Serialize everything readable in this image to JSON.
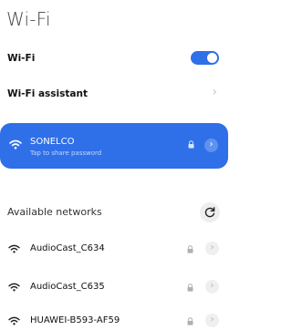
{
  "page": {
    "title": "Wi-Fi"
  },
  "wifi_toggle": {
    "label": "Wi-Fi",
    "state": "on",
    "accent_color": "#2f6fe8"
  },
  "wifi_assistant": {
    "label": "Wi-Fi assistant",
    "chevron": "chevron-right-icon"
  },
  "connected_network": {
    "ssid": "SONELCO",
    "subtitle": "Tap to share password",
    "secured": true,
    "info_glyph": "›",
    "background": "#2f6fe8"
  },
  "available": {
    "label": "Available networks",
    "refresh_icon": "refresh-icon",
    "networks": [
      {
        "ssid": "AudioCast_C634",
        "secured": true,
        "info_glyph": "›"
      },
      {
        "ssid": "AudioCast_C635",
        "secured": true,
        "info_glyph": "›"
      },
      {
        "ssid": "HUAWEI-B593-AF59",
        "secured": true,
        "info_glyph": "›"
      }
    ]
  }
}
